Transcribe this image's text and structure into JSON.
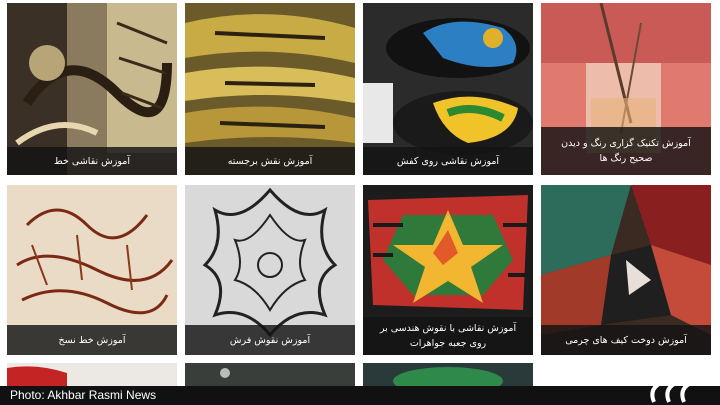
{
  "tiles": [
    {
      "caption": "آموزش نقاشی خط"
    },
    {
      "caption": "آموزش نقش برجسته"
    },
    {
      "caption": "آموزش نقاشی روی کفش"
    },
    {
      "caption": "آموزش تکنیک گزاری رنگ و دیدن صحیح رنگ ها"
    },
    {
      "caption": "آموزش خط نسخ"
    },
    {
      "caption": "آموزش نقوش فرش"
    },
    {
      "caption": "آموزش نقاشی با نقوش هندسی بر روی جعبه جواهرات"
    },
    {
      "caption": "آموزش دوخت کیف های چرمی"
    }
  ],
  "credit": "Photo: Akhbar Rasmi News",
  "colors": {
    "caption_bg": "#141414",
    "credit_bg": "#111111"
  }
}
